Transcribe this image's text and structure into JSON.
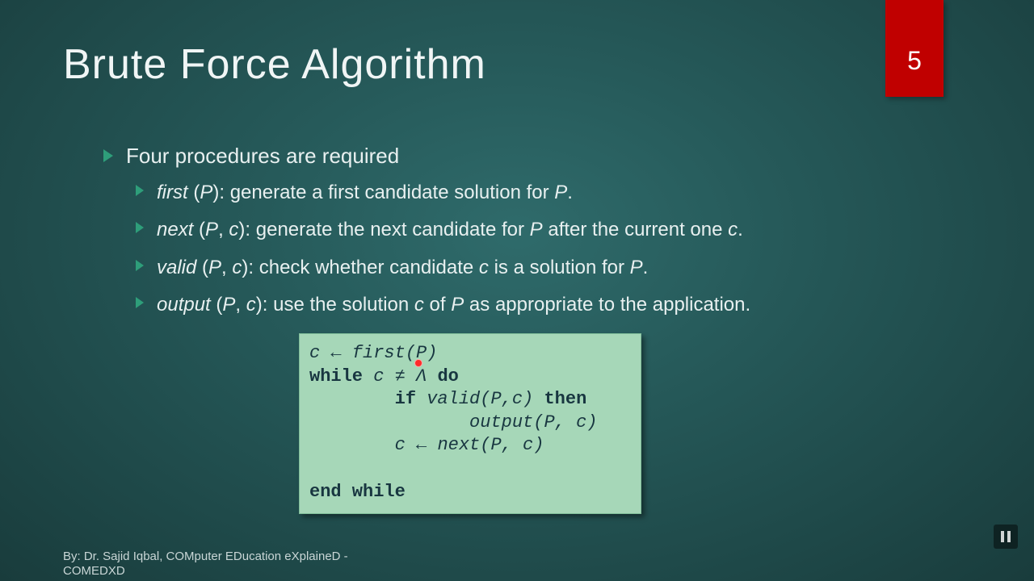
{
  "slide_number": "5",
  "title": "Brute Force Algorithm",
  "lead": "Four procedures are required",
  "procedures": [
    {
      "name": "first",
      "args": "(P)",
      "desc": ": generate a first candidate solution for ",
      "tail_italic": "P",
      "tail_plain": "."
    },
    {
      "name": "next",
      "args": "(P, c)",
      "desc": ": generate the next candidate for ",
      "tail_italic": "P",
      "tail_plain": " after the current one ",
      "tail2_italic": "c",
      "tail2_plain": "."
    },
    {
      "name": "valid",
      "args": "(P, c)",
      "desc": ": check whether candidate ",
      "tail_italic": "c",
      "tail_plain": " is a solution for ",
      "tail2_italic": "P",
      "tail2_plain": "."
    },
    {
      "name": "output",
      "args": "(P, c)",
      "desc": ": use the solution ",
      "tail_italic": "c",
      "tail_plain": " of ",
      "tail2_italic": "P",
      "tail2_plain": " as appropriate to the application."
    }
  ],
  "code": {
    "l1_var": "c ← ",
    "l1_fn": "first",
    "l1_arg": "(P)",
    "l2_kw1": "while",
    "l2_mid": " c ≠ Λ ",
    "l2_kw2": "do",
    "l3_pad": "        ",
    "l3_kw": "if",
    "l3_sp": " ",
    "l3_fn": "valid",
    "l3_arg": "(P,c)",
    "l3_sp2": " ",
    "l3_kw2": "then",
    "l4_pad": "               ",
    "l4_fn": "output",
    "l4_arg": "(P, c)",
    "l5_pad": "        ",
    "l5_var": "c ← ",
    "l5_fn": "next",
    "l5_arg": "(P, c)",
    "l6_kw": "end while"
  },
  "footer": {
    "line1": "By: Dr. Sajid Iqbal, COMputer EDucation eXplaineD -",
    "line2": "COMEDXD"
  }
}
